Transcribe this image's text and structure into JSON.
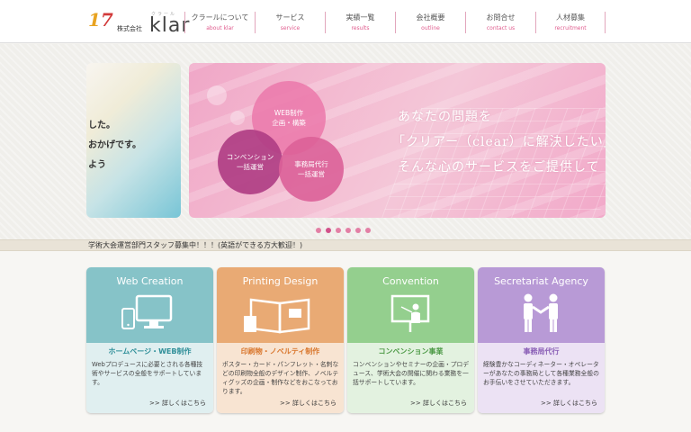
{
  "header": {
    "logo": {
      "ruby": "クラール",
      "company_prefix": "株式会社",
      "brand_name": "klar"
    },
    "nav": [
      {
        "label": "クラールについて",
        "sub": "about klar"
      },
      {
        "label": "サービス",
        "sub": "service"
      },
      {
        "label": "実績一覧",
        "sub": "results"
      },
      {
        "label": "会社概要",
        "sub": "outline"
      },
      {
        "label": "お問合せ",
        "sub": "contact us"
      },
      {
        "label": "人材募集",
        "sub": "recruitment"
      }
    ]
  },
  "slider": {
    "prev_slide_lines": [
      "した。",
      "おかげです。",
      "よう"
    ],
    "bubbles": {
      "web": [
        "WEB制作",
        "企画・構築"
      ],
      "convention": [
        "コンベンション",
        "一括運営"
      ],
      "office": [
        "事務局代行",
        "一括運営"
      ]
    },
    "headline_lines": [
      "あなたの問題を",
      "「クリアー（clear）に解決したい」",
      "そんな心のサービスをご提供して"
    ],
    "dot_count": 6,
    "active_dot": 1
  },
  "news": {
    "text": "学術大会運営部門スタッフ募集中！！！(英語ができる方大歓迎！)"
  },
  "services": [
    {
      "title_en": "Web Creation",
      "title_jp": "ホームページ・WEB制作",
      "description": "Webプロデュースに必要とされる各種技術やサービスの全般をサポートしています。",
      "more": "詳しくはこちら",
      "icon": "devices-icon",
      "top_color": "#86c3c8",
      "bottom_color": "#e0eff0",
      "jp_color": "#2f8f99"
    },
    {
      "title_en": "Printing Design",
      "title_jp": "印刷物・ノベルティ制作",
      "description": "ポスター・カード・パンフレット・名刺などの印刷物全般のデザイン制作、ノベルティグッズの企画・制作などをおこなっております。",
      "more": "詳しくはこちら",
      "icon": "brochure-icon",
      "top_color": "#e9aa74",
      "bottom_color": "#f8e4d2",
      "jp_color": "#d9762c"
    },
    {
      "title_en": "Convention",
      "title_jp": "コンベンション事業",
      "description": "コンベンションやセミナーの企画・プロデュース、学術大会の開催に関わる業務を一括サポートしています。",
      "more": "詳しくはこちら",
      "icon": "presentation-icon",
      "top_color": "#94cf8e",
      "bottom_color": "#e3f2e0",
      "jp_color": "#4f9b48"
    },
    {
      "title_en": "Secretariat Agency",
      "title_jp": "事務局代行",
      "description": "経験豊かなコーディネーター・オペレーターがあなたの事務局として各種業務全般のお手伝いをさせていただきます。",
      "more": "詳しくはこちら",
      "icon": "handshake-icon",
      "top_color": "#b89ad6",
      "bottom_color": "#ece2f4",
      "jp_color": "#8a5fb6"
    }
  ]
}
